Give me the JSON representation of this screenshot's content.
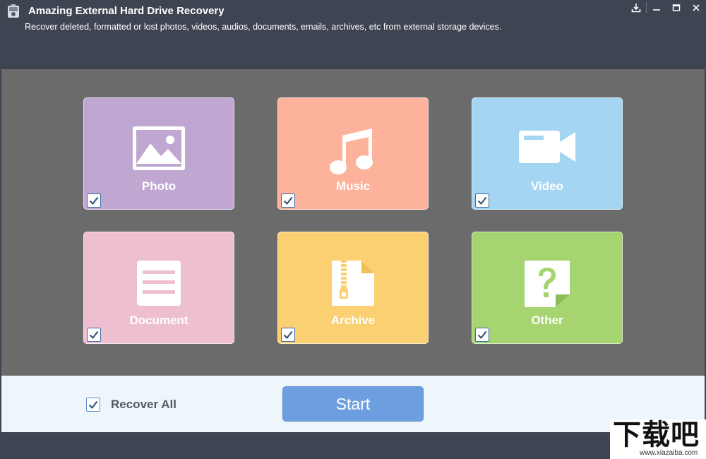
{
  "window": {
    "title": "Amazing External Hard Drive Recovery",
    "subtitle": "Recover deleted, formatted or lost photos, videos, audios, documents, emails, archives, etc from external storage devices."
  },
  "categories": [
    {
      "label": "Photo",
      "icon": "image-icon",
      "color": "#c0a7d2",
      "checked": true
    },
    {
      "label": "Music",
      "icon": "music-note-icon",
      "color": "#fdb29b",
      "checked": true
    },
    {
      "label": "Video",
      "icon": "video-camera-icon",
      "color": "#a4d5f2",
      "checked": true
    },
    {
      "label": "Document",
      "icon": "document-icon",
      "color": "#edbfd0",
      "checked": true
    },
    {
      "label": "Archive",
      "icon": "zip-file-icon",
      "color": "#fad072",
      "checked": true
    },
    {
      "label": "Other",
      "icon": "question-file-icon",
      "color": "#a6d470",
      "checked": true
    }
  ],
  "bottom": {
    "recover_all_label": "Recover All",
    "recover_all_checked": true,
    "start_label": "Start"
  },
  "watermark": {
    "text": "下载吧",
    "url": "www.xiazaiba.com"
  }
}
